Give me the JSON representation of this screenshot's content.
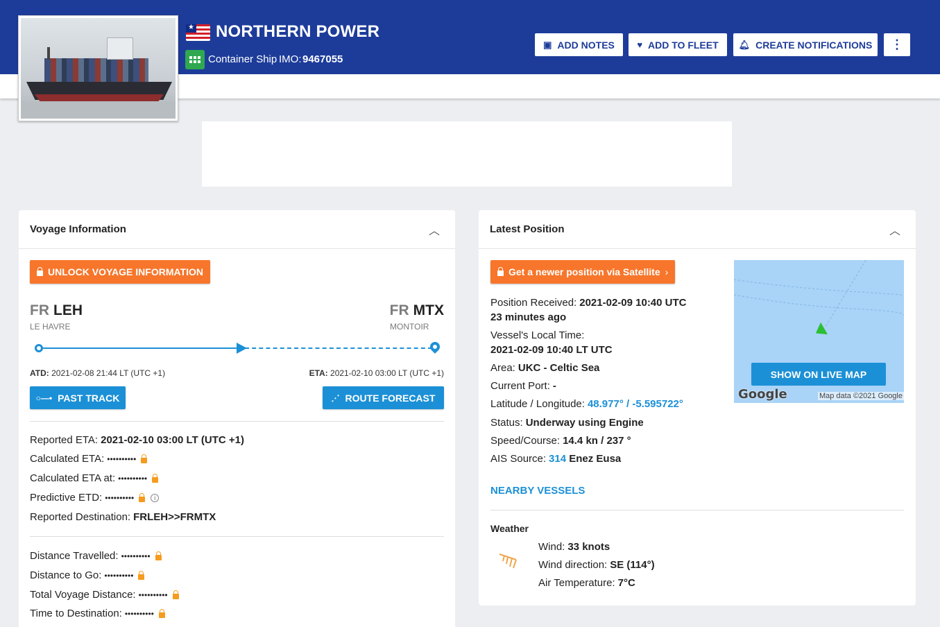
{
  "vessel": {
    "name": "NORTHERN POWER",
    "type": "Container Ship",
    "imo_label": "IMO:",
    "imo": "9467055",
    "flag_icon": "liberia-flag-icon",
    "type_icon": "container-ship-icon"
  },
  "actions": {
    "add_notes": "ADD NOTES",
    "add_to_fleet": "ADD TO FLEET",
    "create_notifications": "CREATE NOTIFICATIONS",
    "more": "⋮"
  },
  "voyage": {
    "title": "Voyage Information",
    "unlock_label": "UNLOCK VOYAGE INFORMATION",
    "from": {
      "country": "FR",
      "code": "LEH",
      "name": "LE HAVRE"
    },
    "to": {
      "country": "FR",
      "code": "MTX",
      "name": "MONTOIR"
    },
    "progress_fraction": 0.52,
    "atd_label": "ATD:",
    "atd": "2021-02-08 21:44 LT (UTC +1)",
    "eta_label": "ETA:",
    "eta": "2021-02-10 03:00 LT (UTC +1)",
    "past_track": "PAST TRACK",
    "route_forecast": "ROUTE FORECAST",
    "details": {
      "reported_eta_label": "Reported ETA:",
      "reported_eta": "2021-02-10 03:00 LT (UTC +1)",
      "calculated_eta_label": "Calculated ETA:",
      "calculated_eta_at_label": "Calculated ETA at:",
      "predictive_etd_label": "Predictive ETD:",
      "reported_destination_label": "Reported Destination:",
      "reported_destination": "FRLEH>>FRMTX",
      "masked": "••••••••••"
    },
    "distance": {
      "travelled_label": "Distance Travelled:",
      "to_go_label": "Distance to Go:",
      "total_label": "Total Voyage Distance:",
      "time_to_dest_label": "Time to Destination:"
    }
  },
  "position": {
    "title": "Latest Position",
    "satellite_label": "Get a newer position via Satellite",
    "received_label": "Position Received:",
    "received": "2021-02-09 10:40 UTC",
    "received_ago": "23 minutes ago",
    "local_time_label": "Vessel's Local Time:",
    "local_time": "2021-02-09 10:40 LT UTC",
    "area_label": "Area:",
    "area": "UKC - Celtic Sea",
    "port_label": "Current Port:",
    "port": "-",
    "latlon_label": "Latitude / Longitude:",
    "latlon": "48.977° / -5.595722°",
    "status_label": "Status:",
    "status": "Underway using Engine",
    "speed_label": "Speed/Course:",
    "speed": "14.4 kn / 237 °",
    "ais_label": "AIS Source:",
    "ais_id": "314",
    "ais_name": "Enez Eusa",
    "map_button": "SHOW ON LIVE MAP",
    "map_logo": "Google",
    "map_attribution": "Map data ©2021 Google",
    "nearby": "NEARBY VESSELS",
    "weather": {
      "title": "Weather",
      "wind_label": "Wind:",
      "wind": "33 knots",
      "direction_label": "Wind direction:",
      "direction": "SE (114°)",
      "temp_label": "Air Temperature:",
      "temp": "7°C"
    }
  },
  "colors": {
    "header": "#1d3c9a",
    "accent_blue": "#1c90d6",
    "orange": "#f7762b",
    "lock": "#f59b1e"
  }
}
